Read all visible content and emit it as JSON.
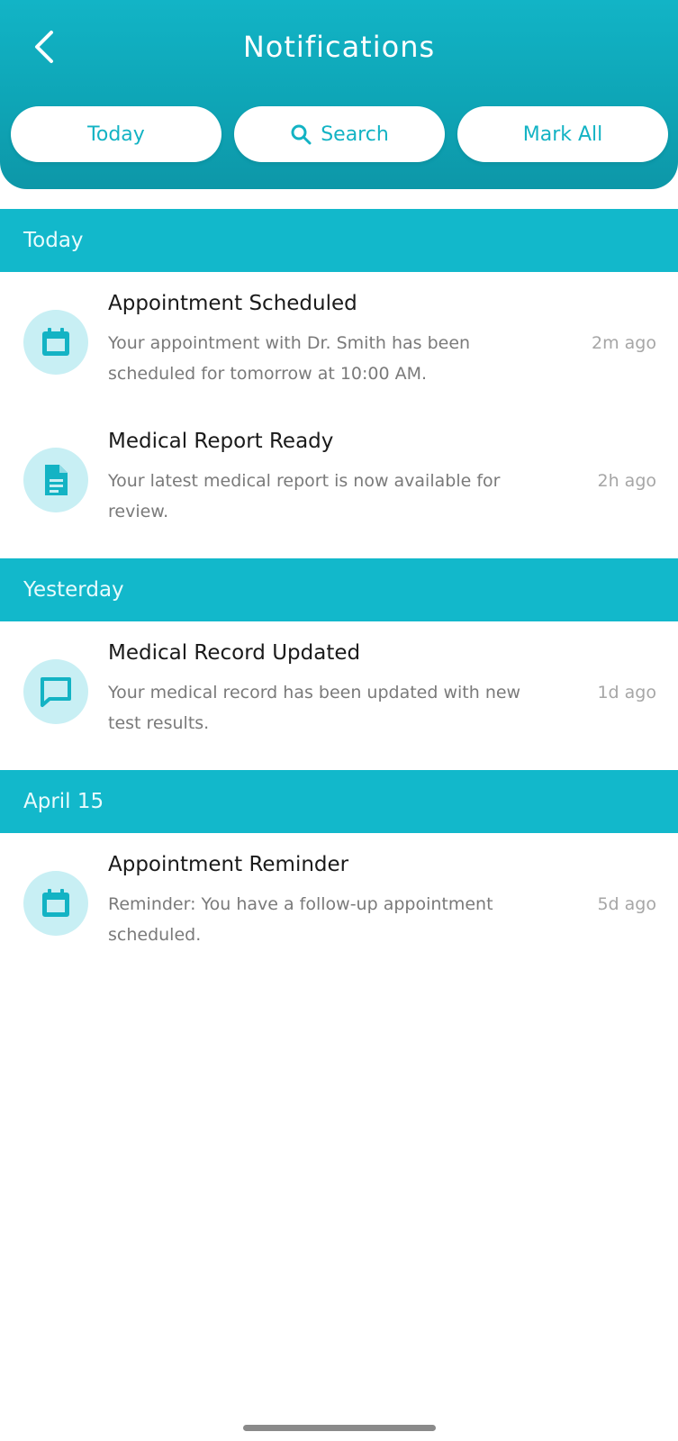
{
  "header": {
    "title": "Notifications",
    "back_icon": "chevron-left-icon"
  },
  "filters": {
    "today_label": "Today",
    "search_label": "Search",
    "search_icon": "search-icon",
    "mark_all_label": "Mark All"
  },
  "sections": [
    {
      "label": "Today",
      "items": [
        {
          "icon": "calendar-icon",
          "title": "Appointment Scheduled",
          "body": "Your appointment with Dr. Smith has been scheduled for tomorrow at 10:00 AM.",
          "time": "2m ago"
        },
        {
          "icon": "document-icon",
          "title": "Medical Report Ready",
          "body": "Your latest medical report is now available for review.",
          "time": "2h ago"
        }
      ]
    },
    {
      "label": "Yesterday",
      "items": [
        {
          "icon": "message-icon",
          "title": "Medical Record Updated",
          "body": "Your medical record has been updated with new test results.",
          "time": "1d ago"
        }
      ]
    },
    {
      "label": "April 15",
      "items": [
        {
          "icon": "calendar-icon",
          "title": "Appointment Reminder",
          "body": "Reminder: You have a follow-up appointment scheduled.",
          "time": "5d ago"
        }
      ]
    }
  ],
  "colors": {
    "accent": "#12b8cb",
    "header_gradient_start": "#12b4c6",
    "header_gradient_end": "#0d97a8",
    "icon_bg": "#c8eff4",
    "title_text": "#1a1a1a",
    "body_text": "#7a7a7a",
    "time_text": "#a6a6a6"
  }
}
